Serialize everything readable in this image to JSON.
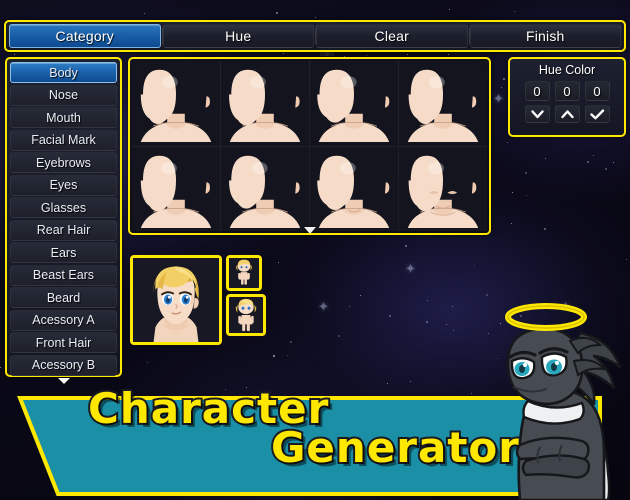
{
  "app": {
    "title": "Character Generator",
    "title_line1": "Character",
    "title_line2": "Generator",
    "accent_yellow": "#ffe800",
    "banner_teal": "#1a8fa6",
    "panel_dark": "#1a1d27",
    "active_blue": "#1b62ab",
    "skin_tone": "#f6dcc8",
    "hair_blond": "#f2cf6a",
    "eye_blue": "#2d7fd0",
    "mascot_body": "#474b52",
    "mascot_eye": "#2aa8bd",
    "background": "space-nebula"
  },
  "toolbar": {
    "watermark_icon": "halo-angel-watermark",
    "tabs": [
      {
        "label": "Category",
        "active": true
      },
      {
        "label": "Hue",
        "active": false
      },
      {
        "label": "Clear",
        "active": false
      },
      {
        "label": "Finish",
        "active": false
      }
    ]
  },
  "sidebar": {
    "scroll_down_icon": "chevron-down-icon",
    "items": [
      {
        "label": "Body",
        "active": true
      },
      {
        "label": "Nose",
        "active": false
      },
      {
        "label": "Mouth",
        "active": false
      },
      {
        "label": "Facial Mark",
        "active": false
      },
      {
        "label": "Eyebrows",
        "active": false
      },
      {
        "label": "Eyes",
        "active": false
      },
      {
        "label": "Glasses",
        "active": false
      },
      {
        "label": "Rear Hair",
        "active": false
      },
      {
        "label": "Ears",
        "active": false
      },
      {
        "label": "Beast Ears",
        "active": false
      },
      {
        "label": "Beard",
        "active": false
      },
      {
        "label": "Acessory A",
        "active": false
      },
      {
        "label": "Front Hair",
        "active": false
      },
      {
        "label": "Acessory B",
        "active": false
      }
    ]
  },
  "grid": {
    "columns": 4,
    "rows": 2,
    "scroll_down_icon": "scroll-down-arrow",
    "items": [
      {
        "name": "body-variant-1",
        "variant": 1,
        "selected": false
      },
      {
        "name": "body-variant-2",
        "variant": 2,
        "selected": false
      },
      {
        "name": "body-variant-3",
        "variant": 3,
        "selected": false
      },
      {
        "name": "body-variant-4",
        "variant": 4,
        "selected": false
      },
      {
        "name": "body-variant-5",
        "variant": 5,
        "selected": false
      },
      {
        "name": "body-variant-6",
        "variant": 6,
        "selected": false
      },
      {
        "name": "body-variant-7",
        "variant": 7,
        "selected": false
      },
      {
        "name": "body-variant-8",
        "variant": 8,
        "selected": false
      }
    ]
  },
  "hue_panel": {
    "title": "Hue Color",
    "values": [
      "0",
      "0",
      "0"
    ],
    "buttons": [
      {
        "icon": "chevron-down-icon",
        "name": "hue-decrease-button"
      },
      {
        "icon": "chevron-up-icon",
        "name": "hue-increase-button"
      },
      {
        "icon": "check-icon",
        "name": "hue-confirm-button"
      }
    ]
  },
  "preview": {
    "face": {
      "name": "character-face-preview",
      "description": "blonde anime character face"
    },
    "walk_sprite": {
      "name": "walk-sprite-preview",
      "description": "chibi walking sprite"
    },
    "battler_sprite": {
      "name": "battler-sprite-preview",
      "description": "chibi sv battler sprite"
    }
  },
  "mascot": {
    "name": "angel-cat-mascot",
    "halo": "yellow-halo",
    "description": "dark gray winged mascot with halo and white scarf, arms crossed"
  }
}
